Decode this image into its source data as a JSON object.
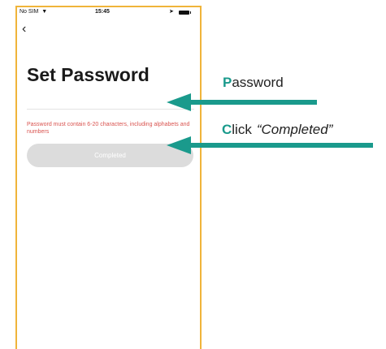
{
  "status_bar": {
    "carrier": "No SIM",
    "time": "15:45"
  },
  "icons": {
    "wifi": "wifi-icon",
    "location": "location-arrow-icon",
    "battery": "battery-icon",
    "back": "chevron-left-icon"
  },
  "screen": {
    "title": "Set Password",
    "password": {
      "value": "",
      "placeholder": ""
    },
    "hint": "Password must contain 6-20 characters, including alphabets and numbers",
    "completed_label": "Completed"
  },
  "annotations": {
    "password": {
      "initial": "P",
      "rest": "assword"
    },
    "click": {
      "initial": "C",
      "rest": "lick",
      "quoted": "“Completed”"
    }
  },
  "colors": {
    "accent_teal": "#1a9a8c",
    "phone_border": "#f0b43a",
    "hint_red": "#d9534f",
    "button_disabled": "#dcdcdc"
  }
}
